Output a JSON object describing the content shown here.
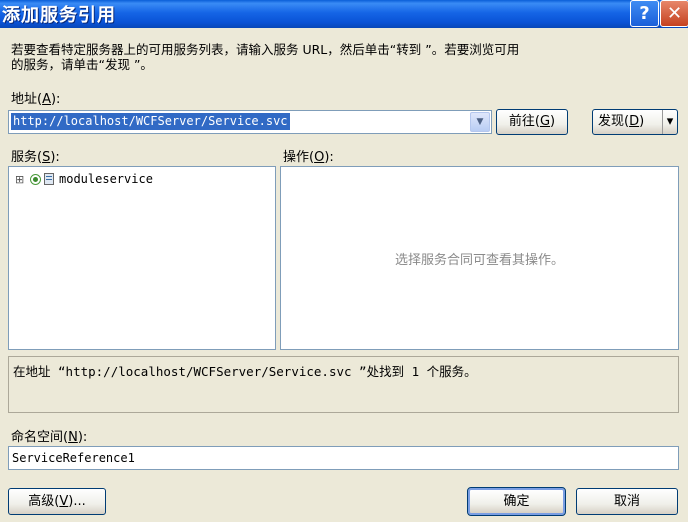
{
  "window": {
    "title": "添加服务引用",
    "help_glyph": "?",
    "close_glyph": "✕"
  },
  "description": {
    "line1": "若要查看特定服务器上的可用服务列表，请输入服务 URL，然后单击“转到 ”。若要浏览可用",
    "line2": "的服务，请单击“发现 ”。"
  },
  "address": {
    "label_pre": "地址(",
    "label_key": "A",
    "label_post": "):",
    "value": "http://localhost/WCFServer/Service.svc",
    "dropdown_glyph": "▼"
  },
  "go_button": {
    "pre": "前往(",
    "key": "G",
    "post": ")"
  },
  "discover_button": {
    "pre": "发现(",
    "key": "D",
    "post": ")",
    "arrow": "▾"
  },
  "services": {
    "label_pre": "服务(",
    "label_key": "S",
    "label_post": "):",
    "items": [
      {
        "expander": "⊞",
        "name": "moduleservice"
      }
    ]
  },
  "operations": {
    "label_pre": "操作(",
    "label_key": "O",
    "label_post": "):",
    "placeholder": "选择服务合同可查看其操作。"
  },
  "status_text": "在地址 “http://localhost/WCFServer/Service.svc ”处找到 1 个服务。",
  "namespace": {
    "label_pre": "命名空间(",
    "label_key": "N",
    "label_post": "):",
    "value": "ServiceReference1"
  },
  "advanced_button": {
    "pre": "高级(",
    "key": "V",
    "post": ")..."
  },
  "ok_label": "确定",
  "cancel_label": "取消",
  "colors": {
    "title_bar": "#1565e6",
    "selection": "#316ac5",
    "dialog_bg": "#ece9d8"
  }
}
